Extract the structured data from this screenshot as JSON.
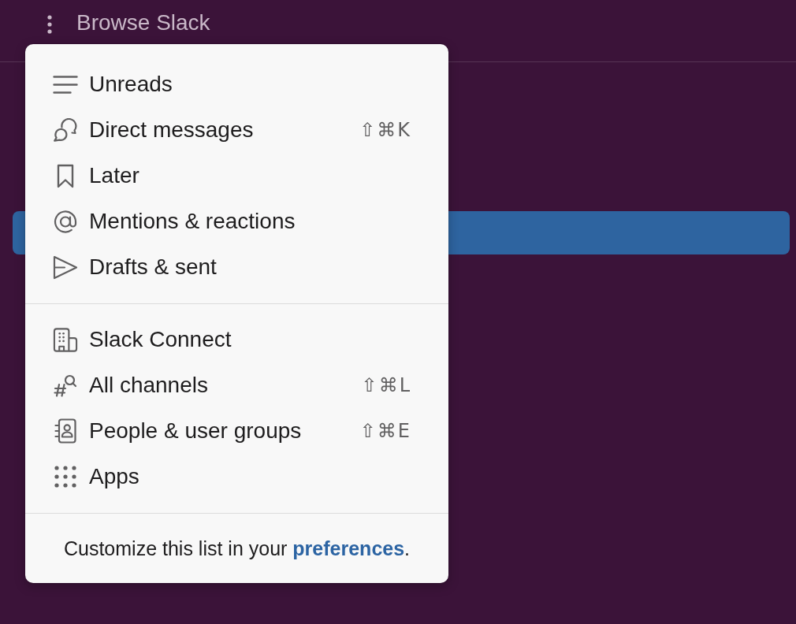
{
  "header": {
    "title": "Browse Slack"
  },
  "sidebar": {
    "items": [
      {
        "selected": true
      }
    ]
  },
  "menu": {
    "sections": [
      {
        "items": [
          {
            "label": "Unreads"
          },
          {
            "label": "Direct messages",
            "shortcut": "⇧⌘K"
          },
          {
            "label": "Later"
          },
          {
            "label": "Mentions & reactions"
          },
          {
            "label": "Drafts & sent"
          }
        ]
      },
      {
        "items": [
          {
            "label": "Slack Connect"
          },
          {
            "label": "All channels",
            "shortcut": "⇧⌘L"
          },
          {
            "label": "People & user groups",
            "shortcut": "⇧⌘E"
          },
          {
            "label": "Apps"
          }
        ]
      }
    ]
  },
  "footer": {
    "text": "Customize this list in your",
    "link": "preferences",
    "after": "."
  }
}
